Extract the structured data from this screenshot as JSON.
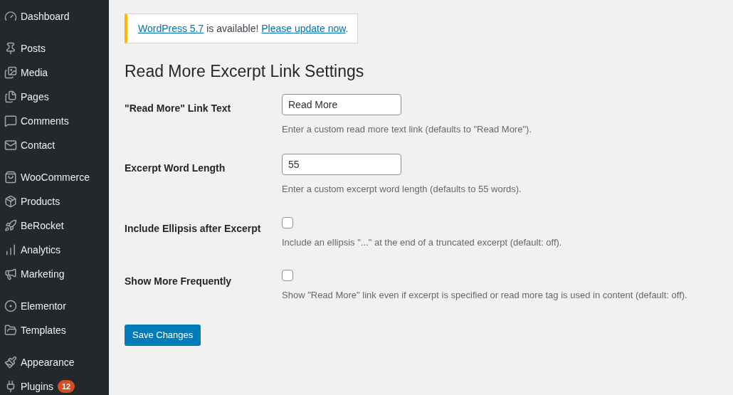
{
  "sidebar": {
    "groups": [
      [
        {
          "label": "Dashboard"
        }
      ],
      [
        {
          "label": "Posts"
        },
        {
          "label": "Media"
        },
        {
          "label": "Pages"
        },
        {
          "label": "Comments"
        },
        {
          "label": "Contact"
        }
      ],
      [
        {
          "label": "WooCommerce"
        },
        {
          "label": "Products"
        },
        {
          "label": "BeRocket"
        },
        {
          "label": "Analytics"
        },
        {
          "label": "Marketing"
        }
      ],
      [
        {
          "label": "Elementor"
        },
        {
          "label": "Templates"
        }
      ],
      [
        {
          "label": "Appearance"
        },
        {
          "label": "Plugins",
          "badge": "12"
        }
      ]
    ]
  },
  "notice": {
    "parts": [
      {
        "kind": "link",
        "text": "WordPress 5.7"
      },
      {
        "kind": "text",
        "text": " is available! "
      },
      {
        "kind": "link",
        "text": "Please update now"
      },
      {
        "kind": "text",
        "text": "."
      }
    ]
  },
  "heading": "Read More Excerpt Link Settings",
  "fields": [
    {
      "kind": "text",
      "label": "\"Read More\" Link Text",
      "value": "Read More",
      "description": "Enter a custom read more text link (defaults to \"Read More\")."
    },
    {
      "kind": "text",
      "label": "Excerpt Word Length",
      "value": "55",
      "description": "Enter a custom excerpt word length (defaults to 55 words)."
    },
    {
      "kind": "checkbox",
      "label": "Include Ellipsis after Excerpt",
      "checked": false,
      "description": "Include an ellipsis \"...\" at the end of a truncated excerpt (default: off)."
    },
    {
      "kind": "checkbox",
      "label": "Show More Frequently",
      "checked": false,
      "description": "Show \"Read More\" link even if excerpt is specified or read more tag is used in content (default: off)."
    }
  ],
  "save_button": "Save Changes"
}
